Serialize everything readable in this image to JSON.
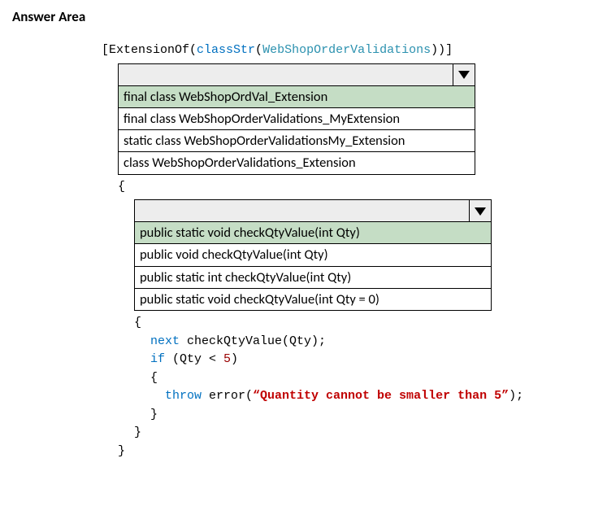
{
  "heading": "Answer Area",
  "attribLine": {
    "open": "[ExtensionOf(",
    "classStr": "classStr",
    "paren1": "(",
    "className": "WebShopOrderValidations",
    "close": "))]"
  },
  "dropdown1": {
    "options": [
      "final class WebShopOrdVal_Extension",
      "final class WebShopOrderValidations_MyExtension",
      "static class WebShopOrderValidationsMy_Extension",
      "class WebShopOrderValidations_Extension"
    ]
  },
  "braceOpen1": "{",
  "dropdown2": {
    "options": [
      "public static void checkQtyValue(int Qty)",
      "public void checkQtyValue(int Qty)",
      "public static int checkQtyValue(int Qty)",
      "public static void checkQtyValue(int Qty = 0)"
    ]
  },
  "methodBody": {
    "braceOpen": "{",
    "nextKw": "next",
    "nextCall": " checkQtyValue(Qty);",
    "ifKw": "if",
    "ifCond1": " (Qty < ",
    "five": "5",
    "ifCond2": ")",
    "innerOpen": "{",
    "throwKw": "throw",
    "errorCall1": " error(",
    "errorMsg": "“Quantity cannot be smaller than 5”",
    "errorCall2": ");",
    "innerClose": "}",
    "braceClose": "}"
  },
  "braceClose1": "}"
}
